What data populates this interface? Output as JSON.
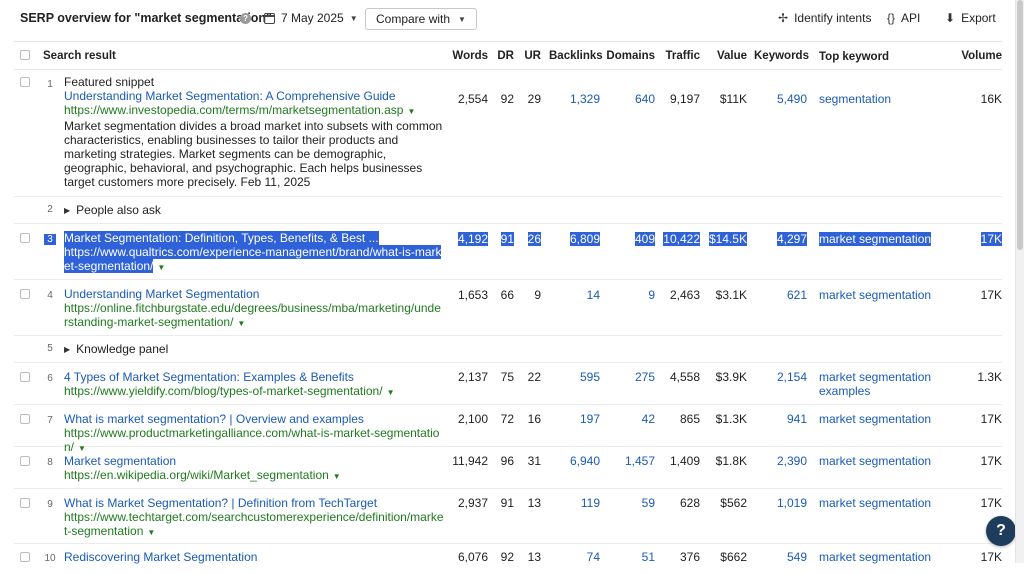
{
  "header": {
    "title": "SERP overview for \"market segmentation\"",
    "date": "7 May 2025",
    "compare_label": "Compare with",
    "identify_label": "Identify intents",
    "api_label": "API",
    "export_label": "Export"
  },
  "columns": {
    "search": "Search result",
    "words": "Words",
    "dr": "DR",
    "ur": "UR",
    "backlinks": "Backlinks",
    "domains": "Domains",
    "traffic": "Traffic",
    "value": "Value",
    "keywords": "Keywords",
    "top_keyword": "Top keyword",
    "volume": "Volume"
  },
  "rows": [
    {
      "num": "1",
      "label": "Featured snippet",
      "title": "Understanding Market Segmentation: A Comprehensive Guide",
      "url": "https://www.investopedia.com/terms/m/marketsegmentation.asp",
      "desc": "Market segmentation divides a broad market into subsets with common characteristics, enabling businesses to tailor their products and marketing strategies. Market segments can be demographic, geographic, behavioral, and psychographic. Each helps businesses target customers more precisely. Feb 11, 2025",
      "words": "2,554",
      "dr": "92",
      "ur": "29",
      "backlinks": "1,329",
      "domains": "640",
      "traffic": "9,197",
      "value": "$11K",
      "keywords": "5,490",
      "top": "segmentation",
      "volume": "16K"
    },
    {
      "num": "2",
      "toggle": "People also ask"
    },
    {
      "num": "3",
      "title": "Market Segmentation: Definition, Types, Benefits, & Best ...",
      "url": "https://www.qualtrics.com/experience-management/brand/what-is-market-segmentation/",
      "words": "4,192",
      "dr": "91",
      "ur": "26",
      "backlinks": "6,809",
      "domains": "409",
      "traffic": "10,422",
      "value": "$14.5K",
      "keywords": "4,297",
      "top": "market segmentation",
      "volume": "17K"
    },
    {
      "num": "4",
      "title": "Understanding Market Segmentation",
      "url": "https://online.fitchburgstate.edu/degrees/business/mba/marketing/understanding-market-segmentation/",
      "words": "1,653",
      "dr": "66",
      "ur": "9",
      "backlinks": "14",
      "domains": "9",
      "traffic": "2,463",
      "value": "$3.1K",
      "keywords": "621",
      "top": "market segmentation",
      "volume": "17K"
    },
    {
      "num": "5",
      "toggle": "Knowledge panel"
    },
    {
      "num": "6",
      "title": "4 Types of Market Segmentation: Examples & Benefits",
      "url": "https://www.yieldify.com/blog/types-of-market-segmentation/",
      "words": "2,137",
      "dr": "75",
      "ur": "22",
      "backlinks": "595",
      "domains": "275",
      "traffic": "4,558",
      "value": "$3.9K",
      "keywords": "2,154",
      "top": "market segmentation examples",
      "volume": "1.3K"
    },
    {
      "num": "7",
      "title": "What is market segmentation? | Overview and examples",
      "url": "https://www.productmarketingalliance.com/what-is-market-segmentation/",
      "words": "2,100",
      "dr": "72",
      "ur": "16",
      "backlinks": "197",
      "domains": "42",
      "traffic": "865",
      "value": "$1.3K",
      "keywords": "941",
      "top": "market segmentation",
      "volume": "17K"
    },
    {
      "num": "8",
      "title": "Market segmentation",
      "url": "https://en.wikipedia.org/wiki/Market_segmentation",
      "words": "11,942",
      "dr": "96",
      "ur": "31",
      "backlinks": "6,940",
      "domains": "1,457",
      "traffic": "1,409",
      "value": "$1.8K",
      "keywords": "2,390",
      "top": "market segmentation",
      "volume": "17K"
    },
    {
      "num": "9",
      "title": "What is Market Segmentation? | Definition from TechTarget",
      "url": "https://www.techtarget.com/searchcustomerexperience/definition/market-segmentation",
      "words": "2,937",
      "dr": "91",
      "ur": "13",
      "backlinks": "119",
      "domains": "59",
      "traffic": "628",
      "value": "$562",
      "keywords": "1,019",
      "top": "market segmentation",
      "volume": "17K"
    },
    {
      "num": "10",
      "title": "Rediscovering Market Segmentation",
      "words": "6,076",
      "dr": "92",
      "ur": "13",
      "backlinks": "74",
      "domains": "51",
      "traffic": "376",
      "value": "$662",
      "keywords": "549",
      "top": "market segmentation",
      "volume": "17K"
    }
  ],
  "help_label": "?"
}
